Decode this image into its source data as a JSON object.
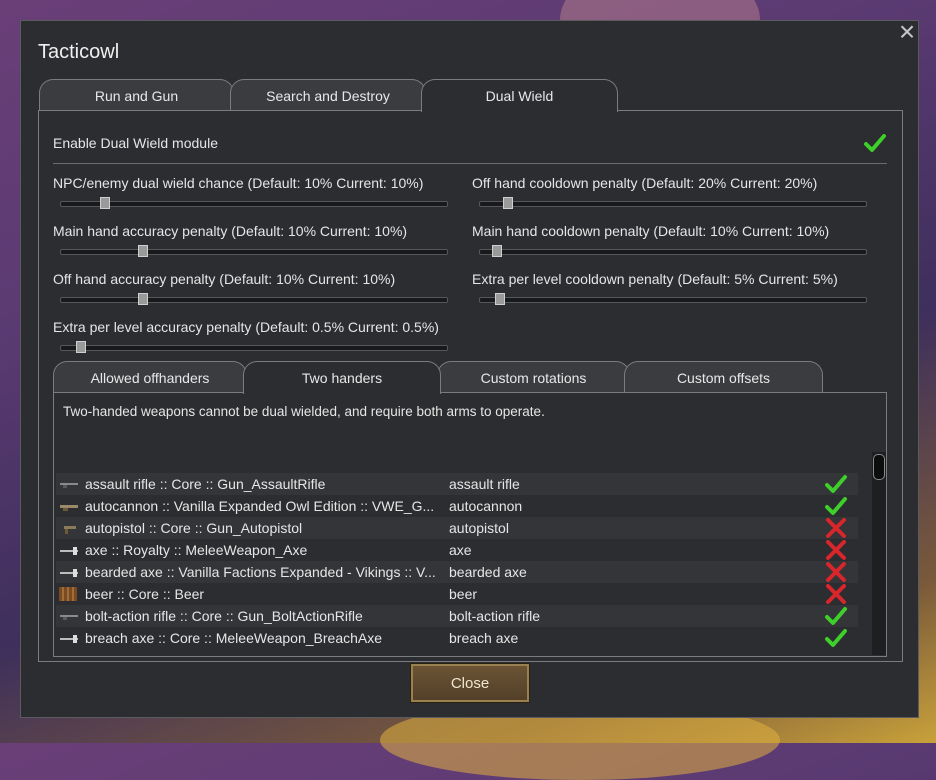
{
  "dialog": {
    "title": "Tacticowl",
    "close_label": "Close",
    "close_icon": "×"
  },
  "tabs": [
    "Run and Gun",
    "Search and Destroy",
    "Dual Wield"
  ],
  "active_tab": "Dual Wield",
  "module": {
    "label": "Enable Dual Wield module",
    "enabled": true
  },
  "sliders": [
    {
      "label": "NPC/enemy dual wield chance (Default: 10% Current: 10%)",
      "value_fraction": 0.1
    },
    {
      "label": "Off hand cooldown penalty (Default: 20% Current: 20%)",
      "value_fraction": 0.06
    },
    {
      "label": "Main hand accuracy penalty (Default: 10% Current: 10%)",
      "value_fraction": 0.2
    },
    {
      "label": "Main hand cooldown penalty (Default: 10% Current: 10%)",
      "value_fraction": 0.03
    },
    {
      "label": "Off hand accuracy penalty (Default: 10% Current: 10%)",
      "value_fraction": 0.2
    },
    {
      "label": "Extra per level cooldown penalty (Default: 5% Current: 5%)",
      "value_fraction": 0.04
    },
    {
      "label": "Extra per level accuracy penalty (Default: 0.5% Current: 0.5%)",
      "value_fraction": 0.04
    }
  ],
  "subtabs": [
    "Allowed offhanders",
    "Two handers",
    "Custom rotations",
    "Custom offsets"
  ],
  "active_subtab": "Two handers",
  "description": "Two-handed weapons cannot be dual wielded, and require both arms to operate.",
  "weapons": [
    {
      "name": "assault rifle :: Core :: Gun_AssaultRifle",
      "label": "assault rifle",
      "two_handed": true,
      "icon": "rifle-icon"
    },
    {
      "name": "autocannon :: Vanilla Expanded Owl Edition :: VWE_G...",
      "label": "autocannon",
      "two_handed": true,
      "icon": "cannon-icon"
    },
    {
      "name": "autopistol :: Core :: Gun_Autopistol",
      "label": "autopistol",
      "two_handed": false,
      "icon": "pistol-icon"
    },
    {
      "name": "axe :: Royalty :: MeleeWeapon_Axe",
      "label": "axe",
      "two_handed": false,
      "icon": "axe-icon"
    },
    {
      "name": "bearded axe :: Vanilla Factions Expanded - Vikings :: V...",
      "label": "bearded axe",
      "two_handed": false,
      "icon": "axe-icon"
    },
    {
      "name": "beer :: Core :: Beer",
      "label": "beer",
      "two_handed": false,
      "icon": "beer-icon"
    },
    {
      "name": "bolt-action rifle :: Core :: Gun_BoltActionRifle",
      "label": "bolt-action rifle",
      "two_handed": true,
      "icon": "rifle-icon"
    },
    {
      "name": "breach axe :: Core :: MeleeWeapon_BreachAxe",
      "label": "breach axe",
      "two_handed": true,
      "icon": "breach-axe-icon"
    }
  ],
  "colors": {
    "check": "#3fcf2a",
    "cross": "#d8262a",
    "accent": "#6a5434"
  }
}
